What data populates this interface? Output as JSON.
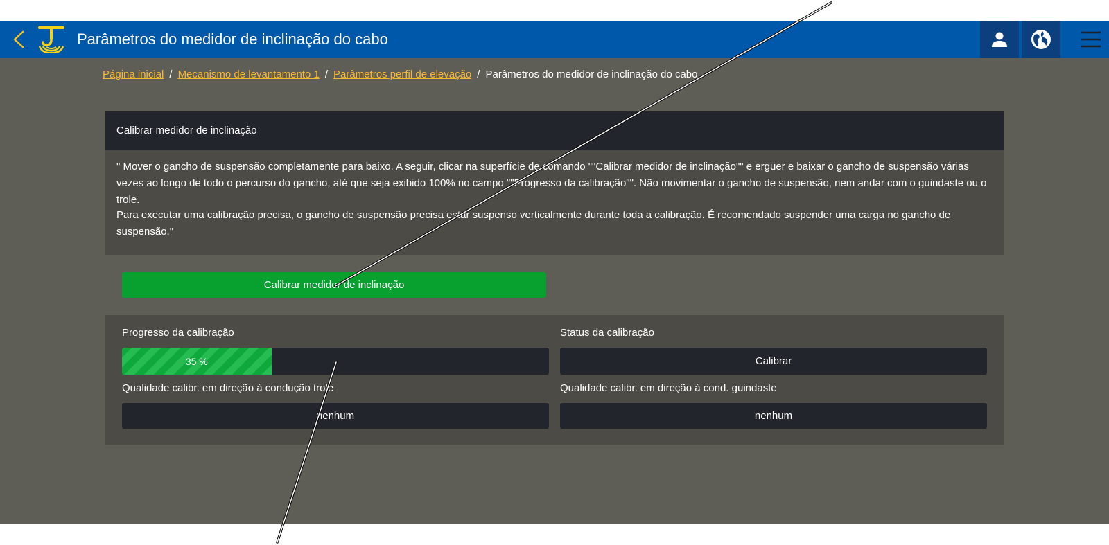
{
  "header": {
    "title": "Parâmetros do medidor de inclinação do cabo",
    "icons": {
      "back": "chevron-left-icon",
      "logo": "crane-hook-logo",
      "user": "user-icon",
      "language": "globe-icon",
      "menu": "hamburger-menu-icon"
    }
  },
  "breadcrumb": {
    "items": [
      "Página inicial",
      "Mecanismo de levantamento 1",
      "Parâmetros perfil de elevação"
    ],
    "current": "Parâmetros do medidor de inclinação do cabo",
    "separator": "/"
  },
  "panel": {
    "title": "Calibrar medidor de inclinação",
    "paragraph1": "\" Mover o gancho de suspensão completamente para baixo. A seguir, clicar na superfície de comando \"\"Calibrar medidor de inclinação\"\" e erguer e baixar o gancho de suspensão várias vezes ao longo de todo o percurso do gancho, até que seja exibido 100% no campo \"\"Progresso da calibração\"\". Não movimentar o gancho de suspensão, nem andar com o guindaste ou o trole.",
    "paragraph2": "Para executar uma calibração precisa, o gancho de suspensão precisa estar suspenso verticalmente durante toda a calibração. É recomendado suspender uma carga no gancho de suspensão.\""
  },
  "calibrate_button": {
    "label": "Calibrar medidor de inclinação"
  },
  "status": {
    "progress_label": "Progresso da calibração",
    "progress_value": 35,
    "progress_text": "35 %",
    "calibration_status_label": "Status da calibração",
    "calibration_status_value": "Calibrar",
    "quality_trolley_label": "Qualidade calibr. em direção à condução trole",
    "quality_trolley_value": "nenhum",
    "quality_crane_label": "Qualidade calibr. em direção à cond. guindaste",
    "quality_crane_value": "nenhum"
  },
  "colors": {
    "header_bg": "#0058aa",
    "header_button_bg": "#0b3f7d",
    "accent_yellow": "#f7b733",
    "content_bg": "#5f5e56",
    "panel_bg": "#4c4b45",
    "dark_box": "#22262c",
    "button_green": "#08a12f",
    "progress_green": "#0fa83a"
  }
}
